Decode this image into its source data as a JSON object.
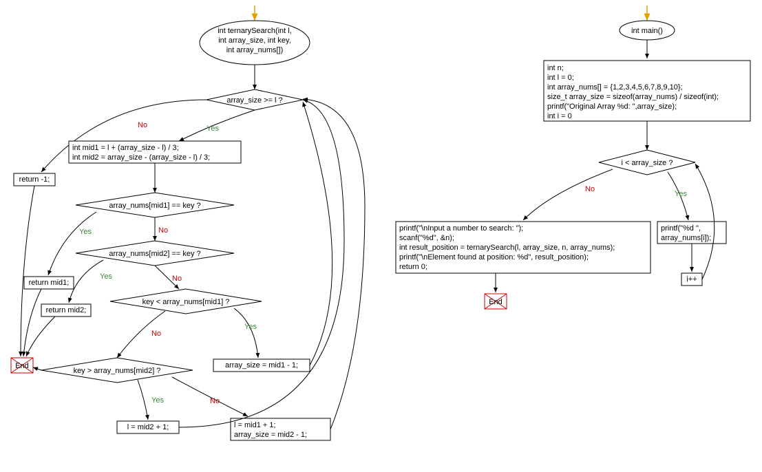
{
  "flowchart_left": {
    "start_arrow": "entry",
    "func_header": "int ternarySearch(int l,\nint array_size, int key,\nint array_nums[])",
    "cond1": "array_size >= l ?",
    "ret_neg1": "return -1;",
    "mids": "int mid1 = l + (array_size - l) / 3;\nint mid2 = array_size - (array_size - l) / 3;",
    "cond2": "array_nums[mid1] == key ?",
    "ret_mid1": "return mid1;",
    "cond3": "array_nums[mid2] == key ?",
    "ret_mid2": "return mid2;",
    "cond4": "key < array_nums[mid1] ?",
    "assign1": "array_size = mid1 - 1;",
    "cond5": "key > array_nums[mid2] ?",
    "assign2": "l = mid2 + 1;",
    "assign3": "l = mid1 + 1;\narray_size = mid2 - 1;",
    "end": "End",
    "yes": "Yes",
    "no": "No"
  },
  "flowchart_right": {
    "func_header": "int main()",
    "init_block": "int n;\nint l = 0;\nint array_nums[] = {1,2,3,4,5,6,7,8,9,10};\nsize_t array_size = sizeof(array_nums) / sizeof(int);\nprintf(\"Original Array %d: \",array_size);\nint i = 0",
    "cond1": "i < array_size ?",
    "print_item": "printf(\"%d \",\narray_nums[i]);",
    "incr": "i++",
    "final_block": "printf(\"\\nInput a number to search: \");\nscanf(\"%d\", &n);\nint result_position = ternarySearch(l, array_size, n, array_nums);\nprintf(\"\\nElement found at position: %d\", result_position);\nreturn 0;",
    "end": "End",
    "yes": "Yes",
    "no": "No"
  }
}
